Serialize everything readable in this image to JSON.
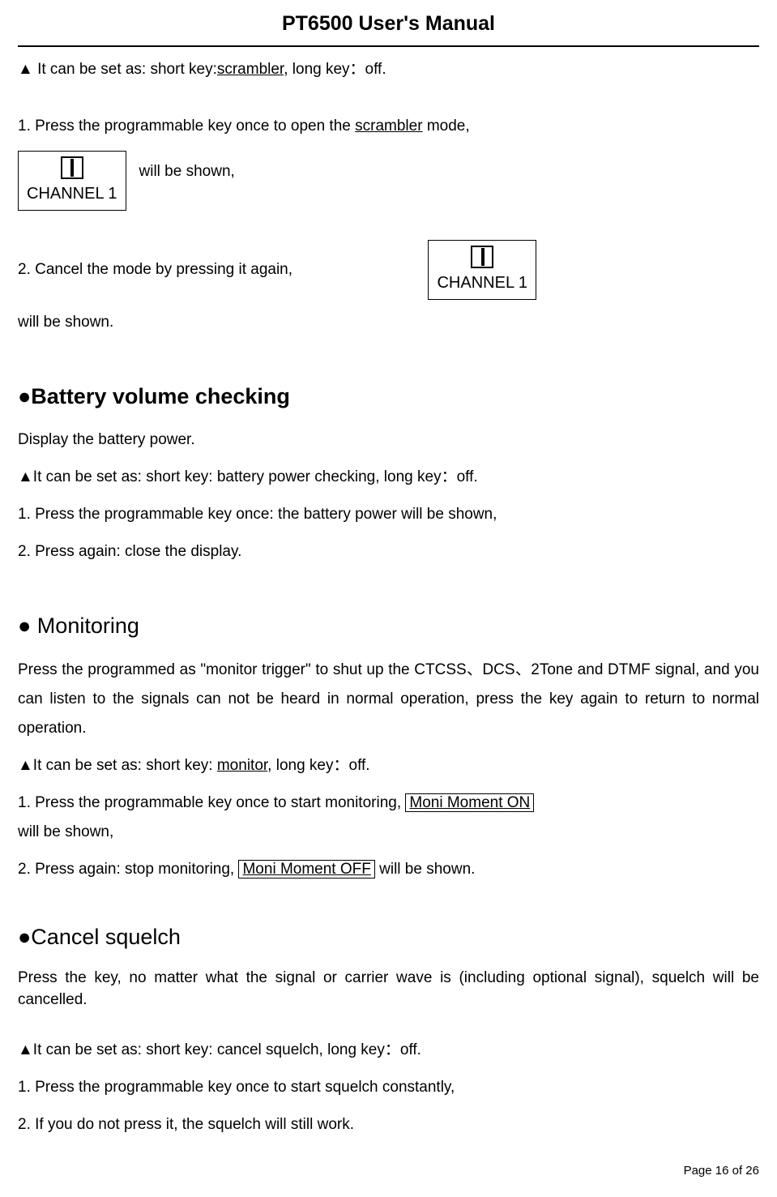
{
  "header": {
    "title": "PT6500 User's Manual"
  },
  "intro": {
    "line1_prefix": "▲  It can be set as: short key: ",
    "line1_underline": "scrambler",
    "line1_suffix": ", long key：off."
  },
  "step1": {
    "prefix": "1. Press the programmable key once to open the ",
    "underline": "scrambler",
    "suffix": " mode,",
    "after_lcd": "will be shown,",
    "lcd_text": "CHANNEL 1"
  },
  "step2": {
    "text_before": "2. Cancel the mode by pressing it again,",
    "lcd_text": "CHANNEL 1",
    "text_after": "will be shown."
  },
  "battery": {
    "heading": "●Battery volume checking",
    "l1": "Display the battery power.",
    "l2": "▲It can be set as: short key: battery power checking, long key：off.",
    "l3": "1. Press the programmable key once: the battery power will be shown,",
    "l4": "2. Press again: close the display."
  },
  "monitoring": {
    "heading": "● Monitoring",
    "p1": "Press the programmed as \"monitor trigger\" to shut up the CTCSS、DCS、2Tone and DTMF signal, and you can listen to the signals can not be heard in normal operation, press the key again to return to normal operation.",
    "l2_prefix": "▲It can be set as: short key: ",
    "l2_underline": "monitor",
    "l2_suffix": ", long key：off.",
    "l3_prefix": "1. Press the programmable key once to start monitoring, ",
    "l3_box": "Moni Moment   ON",
    "l4": "will be shown,",
    "l5_prefix": "2. Press again: stop monitoring, ",
    "l5_box": "Moni Moment   OFF",
    "l5_suffix": " will be shown."
  },
  "squelch": {
    "heading": "●Cancel squelch",
    "p1": "Press the key, no matter what the signal or carrier wave is (including optional signal), squelch will be cancelled.",
    "l2": "▲It can be set as: short key: cancel squelch, long key：off.",
    "l3": "1. Press the programmable key once to start squelch constantly,",
    "l4": "2. If you do not press it, the squelch will still work."
  },
  "footer": {
    "page": "Page 16 of 26"
  }
}
